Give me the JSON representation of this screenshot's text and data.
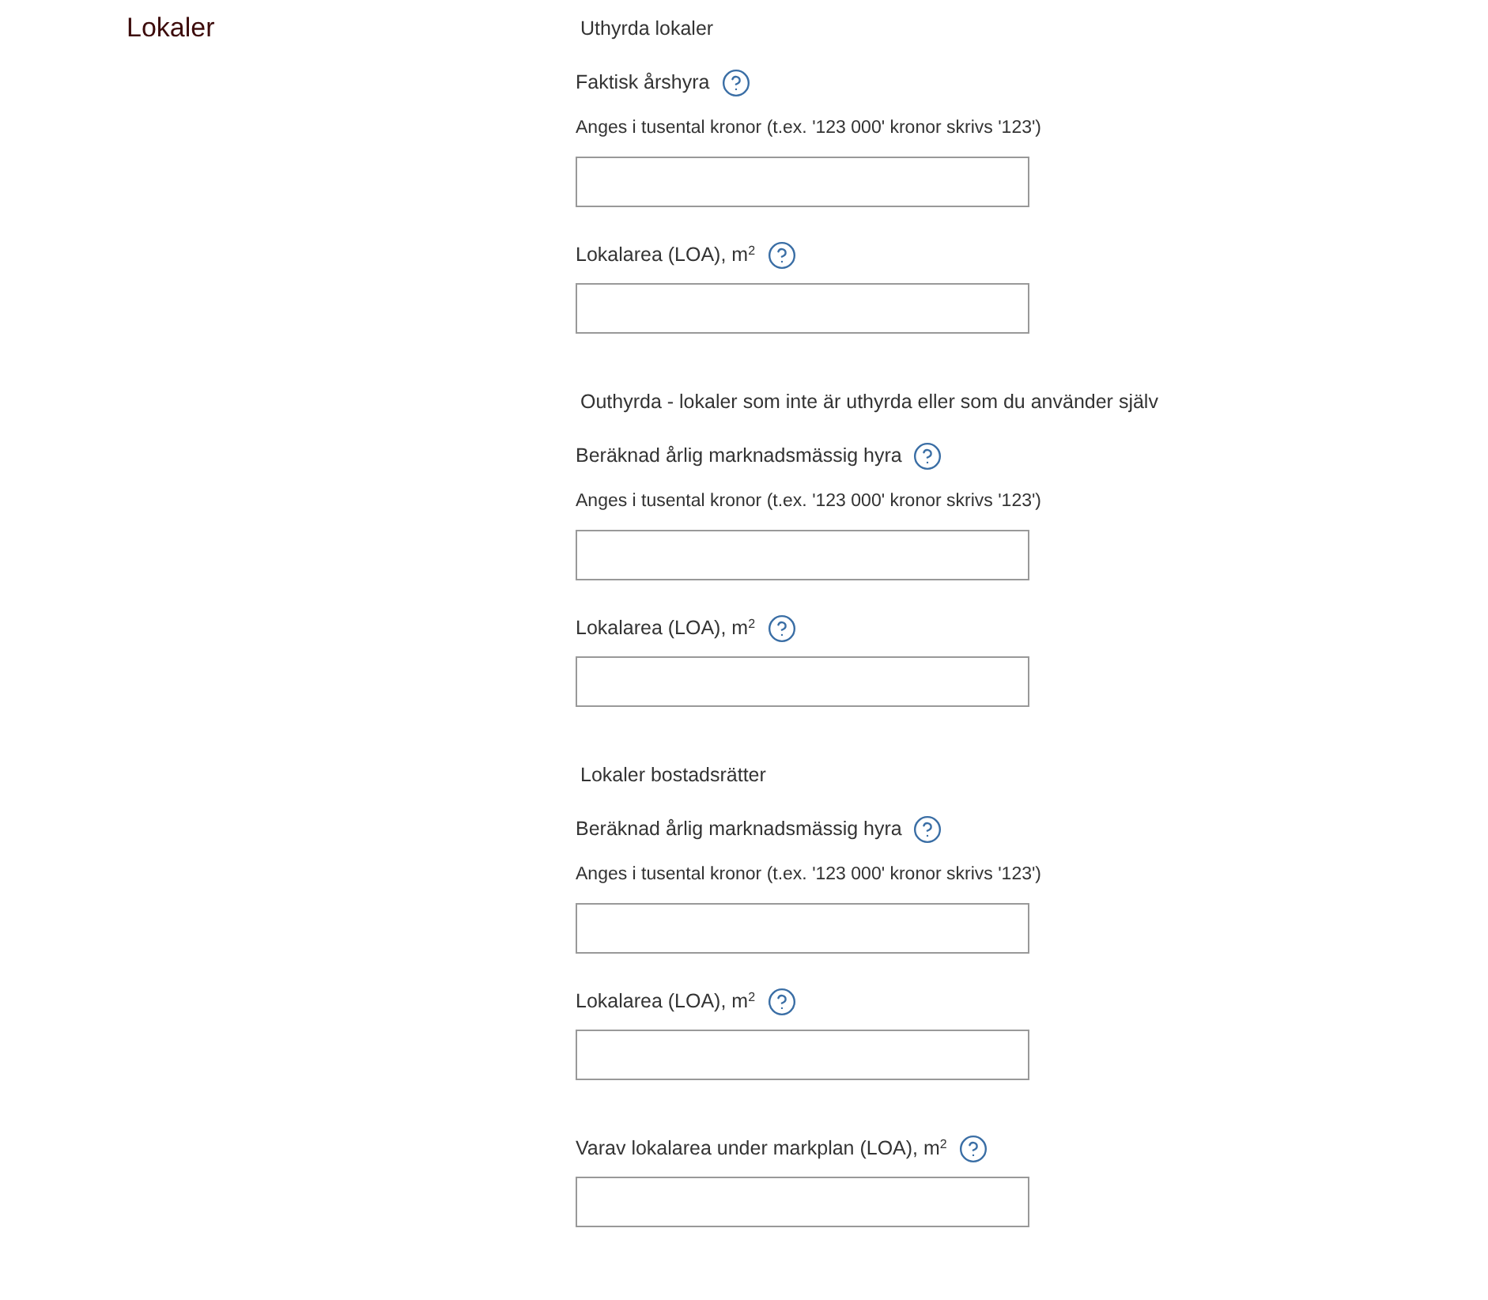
{
  "heading": "Lokaler",
  "sections": [
    {
      "title": "Uthyrda lokaler",
      "fields": [
        {
          "label": "Faktisk årshyra",
          "hint": "Anges i tusental kronor (t.ex. '123 000' kronor skrivs '123')"
        },
        {
          "label": "Lokalarea (LOA), m$^{2}$"
        }
      ]
    },
    {
      "title": "Outhyrda - lokaler som inte är uthyrda eller som du använder själv",
      "fields": [
        {
          "label": "Beräknad årlig marknadsmässig hyra",
          "hint": "Anges i tusental kronor (t.ex. '123 000' kronor skrivs '123')"
        },
        {
          "label": "Lokalarea (LOA), m$^{2}$"
        }
      ]
    },
    {
      "title": "Lokaler bostadsrätter",
      "fields": [
        {
          "label": "Beräknad årlig marknadsmässig hyra",
          "hint": "Anges i tusental kronor (t.ex. '123 000' kronor skrivs '123')"
        },
        {
          "label": "Lokalarea (LOA), m$^{2}$"
        }
      ]
    },
    {
      "fields": [
        {
          "label": "Varav lokalarea under markplan (LOA), m$^{2}$"
        }
      ]
    }
  ]
}
